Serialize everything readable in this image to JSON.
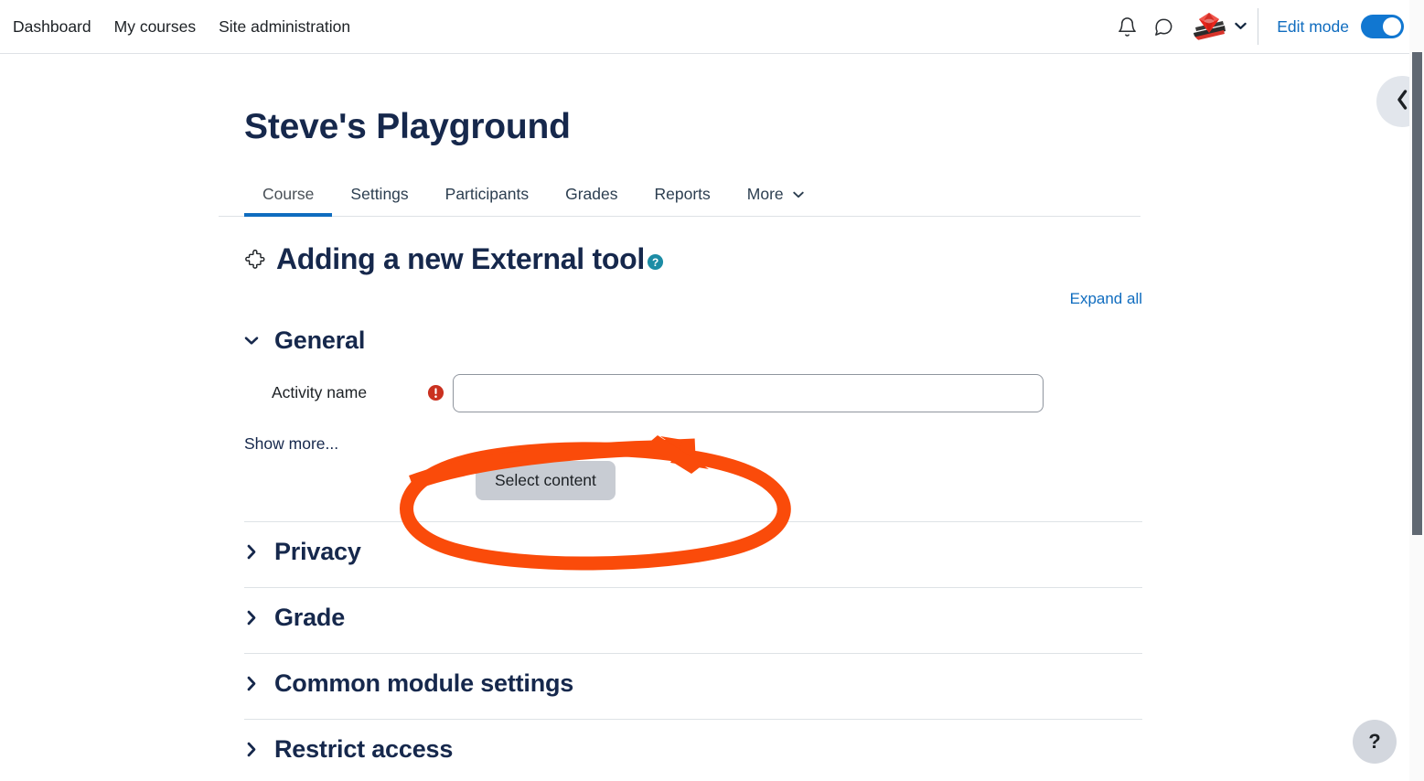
{
  "navbar": {
    "links": [
      {
        "label": "Dashboard",
        "name": "nav-link-dashboard"
      },
      {
        "label": "My courses",
        "name": "nav-link-my-courses"
      },
      {
        "label": "Site administration",
        "name": "nav-link-site-administration"
      }
    ],
    "notification_icon": "bell-icon",
    "messages_icon": "speech-bubble-icon",
    "avatar_icon": "user-avatar",
    "avatar_caret_icon": "chevron-down-icon",
    "edit_mode_label": "Edit mode",
    "edit_mode_on": true
  },
  "course": {
    "title": "Steve's Playground",
    "tabs": [
      {
        "label": "Course",
        "active": true
      },
      {
        "label": "Settings",
        "active": false
      },
      {
        "label": "Participants",
        "active": false
      },
      {
        "label": "Grades",
        "active": false
      },
      {
        "label": "Reports",
        "active": false
      },
      {
        "label": "More",
        "active": false,
        "caret": "⌄"
      }
    ]
  },
  "activity": {
    "icon": "puzzle-piece-icon",
    "heading": "Adding a new External tool",
    "help_icon": "question-mark-help-icon",
    "expand_all_label": "Expand all"
  },
  "form": {
    "sections": [
      {
        "title": "General",
        "expanded": true,
        "chevron": "⌄"
      },
      {
        "title": "Privacy",
        "expanded": false,
        "chevron": "›"
      },
      {
        "title": "Grade",
        "expanded": false,
        "chevron": "›"
      },
      {
        "title": "Common module settings",
        "expanded": false,
        "chevron": "›"
      },
      {
        "title": "Restrict access",
        "expanded": false,
        "chevron": "›"
      }
    ],
    "activity_name": {
      "label": "Activity name",
      "value": "",
      "placeholder": "",
      "required_icon": "required-exclamation-icon"
    },
    "show_more_label": "Show more...",
    "select_content_label": "Select content"
  },
  "chrome": {
    "drawer_toggle_icon": "chevron-left-icon",
    "help_fab_label": "?",
    "scrollbar": "vertical-scrollbar"
  },
  "annotation": {
    "color": "#FA4B0A",
    "shapes": [
      "ellipse-highlight",
      "arrow-pointing-up-right"
    ],
    "targets": "Select content"
  },
  "colors": {
    "brand_blue": "#0f6cbf",
    "heading_navy": "#16284c",
    "required_red": "#ca3120",
    "help_teal": "#1c8ca5",
    "annotation_orange": "#FA4B0A",
    "button_gray": "#c8ccd3"
  }
}
